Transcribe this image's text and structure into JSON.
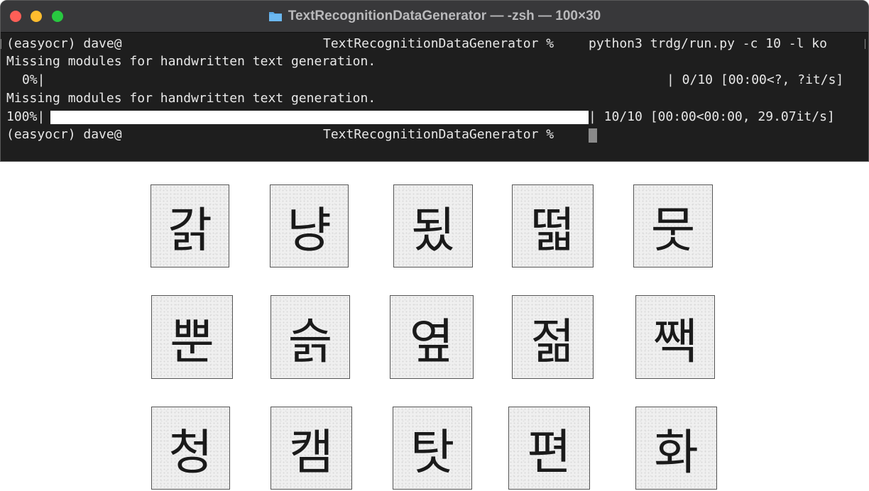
{
  "window": {
    "title": "TextRecognitionDataGenerator — -zsh — 100×30"
  },
  "terminal": {
    "prompt_user": "(easyocr) dave@",
    "prompt_dir": "TextRecognitionDataGenerator %",
    "command": "python3 trdg/run.py -c 10 -l ko",
    "warning": "Missing modules for handwritten text generation.",
    "progress1_pct": "0%|",
    "progress1_stats": "| 0/10 [00:00<?, ?it/s]",
    "progress2_pct": "100%|",
    "progress2_stats": "| 10/10 [00:00<00:00, 29.07it/s]",
    "progress2_value": 1.0
  },
  "samples": [
    [
      "갉",
      "냥",
      "됬",
      "떫",
      "뭇"
    ],
    [
      "뿐",
      "슭",
      "옆",
      "젊",
      "짹"
    ],
    [
      "청",
      "캠",
      "탓",
      "편",
      "화"
    ]
  ]
}
